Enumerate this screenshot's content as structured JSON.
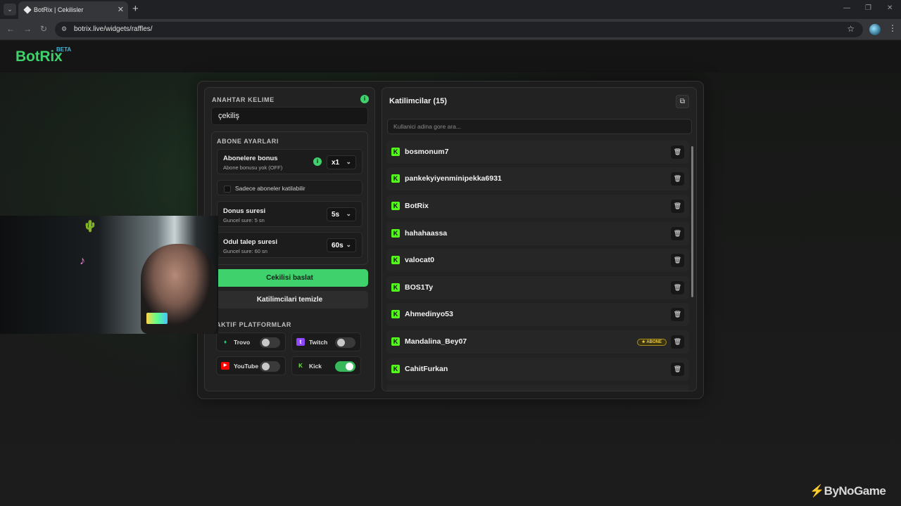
{
  "browser": {
    "tab_title": "BotRix | Cekilisler",
    "url": "botrix.live/widgets/raffles/",
    "icons": [
      "tab-list-icon",
      "close-icon",
      "plus-icon",
      "back-icon",
      "forward-icon",
      "reload-icon",
      "site-info-icon",
      "star-icon",
      "menu-icon"
    ]
  },
  "brand": {
    "logo": "BotRix",
    "beta": "BETA",
    "color": "#3fd16c"
  },
  "settings": {
    "keyword_title": "ANAHTAR KELIME",
    "keyword_value": "çekiliş",
    "sub_title": "ABONE AYARLARI",
    "bonus_label": "Abonelere bonus",
    "bonus_sub": "Abone bonusu yok (OFF)",
    "bonus_value": "x1",
    "only_subs_label": "Sadece aboneler katilabilir",
    "bonus_time_label": "Donus suresi",
    "bonus_time_sub": "Guncel sure: 5 sn",
    "bonus_time_value": "5s",
    "claim_label": "Odul talep suresi",
    "claim_sub": "Guncel sure: 60 sn",
    "claim_value": "60s",
    "start_button": "Cekilisi baslat",
    "clear_button": "Katilimcilari temizle",
    "platforms_title": "AKTIF PLATFORMLAR",
    "platforms": [
      {
        "name": "Trovo",
        "enabled": false,
        "color": "#19d66b"
      },
      {
        "name": "Twitch",
        "enabled": false,
        "color": "#9146ff"
      },
      {
        "name": "YouTube",
        "enabled": false,
        "color": "#ff0000"
      },
      {
        "name": "Kick",
        "enabled": true,
        "color": "#53fc18"
      }
    ]
  },
  "participants": {
    "title": "Katilimcilar (15)",
    "search_placeholder": "Kullanici adina gore ara...",
    "items": [
      {
        "name": "bosmonum7",
        "badge": ""
      },
      {
        "name": "pankekyiyenminipekka6931",
        "badge": ""
      },
      {
        "name": "BotRix",
        "badge": ""
      },
      {
        "name": "hahahaassa",
        "badge": ""
      },
      {
        "name": "valocat0",
        "badge": ""
      },
      {
        "name": "BOS1Ty",
        "badge": ""
      },
      {
        "name": "Ahmedinyo53",
        "badge": ""
      },
      {
        "name": "Mandalina_Bey07",
        "badge": "★ ABONE"
      },
      {
        "name": "CahitFurkan",
        "badge": ""
      }
    ]
  },
  "watermark": "ByNoGame"
}
